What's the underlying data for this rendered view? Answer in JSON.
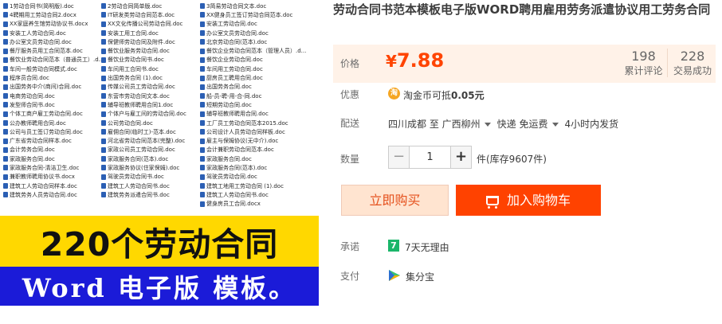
{
  "image": {
    "file_columns": [
      [
        "1劳动合同书(简明版).doc",
        "4聘期用工劳动合同2.docx",
        "XX家庭养生馆劳动协议书.docx",
        "安装工人劳动合同.doc",
        "办公室文员劳动合同.doc",
        "餐厅服务员用工合同范本.doc",
        "餐饮业劳动合同范本（普通员工）.d...",
        "车间一般劳动合同模式.doc",
        "程序员合同.doc",
        "出国劳务中介(商间)合同.doc",
        "电商劳动合同.doc",
        "发型师合同书.doc",
        "个体工商户雇工劳动合同.doc",
        "公办教师聘用合同.doc",
        "公司与员工签订劳动合同.doc",
        "广东省劳动合同样本.doc",
        "会计劳务合同.doc",
        "家政服务合同.doc",
        "家政服务合同-清洁卫生.doc",
        "兼职教师聘用协议书.docx",
        "建筑工人劳动合同样本.doc",
        "建筑劳务人员劳动合同.doc"
      ],
      [
        "2劳动合同简单版.doc",
        "IT研发类劳动合同范本.doc",
        "XX文化传播公司劳动合同.doc",
        "安装工用工合同.doc",
        "保健师劳动合同及附件.doc",
        "餐饮业服务劳动合同.doc",
        "餐饮业劳动合同书.doc",
        "车间用工合同书.doc",
        "出国劳务合同 (1).doc",
        "传媒公司员工劳动合同.doc",
        "东营市劳动合同文本.doc",
        "辅导班教师聘用合同1.doc",
        "个体户与雇工间的劳动合同.doc",
        "公司劳动合同.doc",
        "雇佣合同(临时工)-范本.doc",
        "河北省劳动合同范本(完整).doc",
        "家政公司员工劳动合同.doc",
        "家政服务合同(范本).doc",
        "家政服务协议(住家保姆).doc",
        "驾驶员劳动合同书.doc",
        "建筑工人劳动合同书.doc",
        "建筑劳务派遣合同书.doc"
      ],
      [
        "3简易劳动合同文本.doc",
        "XX健身员工签订劳动合同范本.doc",
        "安装工劳动合同.doc",
        "办公室文员劳动合同.doc",
        "北京劳动合同(范本).doc",
        "餐饮企业劳动合同范本（管理人员）.d...",
        "餐饮企业劳动合同.doc",
        "车间用工劳动合同.doc",
        "厨房员工聘用合同.doc",
        "出国劳务合同.doc",
        "船-员-聘-用-合-同.doc",
        "短期劳动合同.doc",
        "辅导班教师聘用合同.doc",
        "工厂员工劳动合同范本2015.doc",
        "公司设计人员劳动合同样板.doc",
        "雇主与保姆协议(无中介).doc",
        "会计兼职劳动合同范本.doc",
        "家政服务合同.doc",
        "家政服务合同(范本).doc",
        "驾驶员劳动合同.doc",
        "建筑工地用工劳动合同 (1).doc",
        "建筑工人劳动合同书.doc",
        "健身房员工合同.docx"
      ]
    ],
    "banner_main": "220个劳动合同",
    "banner_sub": "Word 电子版 模板。"
  },
  "product": {
    "title": "劳动合同书范本模板电子版WORD聘用雇用劳务派遣协议用工劳务合同",
    "price_label": "价格",
    "currency": "¥",
    "price": "7.88",
    "stats": [
      {
        "num": "198",
        "label": "累计评论"
      },
      {
        "num": "228",
        "label": "交易成功"
      }
    ],
    "discount_label": "优惠",
    "coin_icon": "淘",
    "coin_text_prefix": "淘金币可抵",
    "coin_amount": "0.05元",
    "ship_label": "配送",
    "ship_from": "四川成都 至",
    "ship_to": "广西柳州",
    "ship_method": "快递 免运费",
    "ship_time": "4小时内发货",
    "qty_label": "数量",
    "qty_value": "1",
    "qty_minus": "−",
    "qty_plus": "+",
    "stock": "件(库存9607件)",
    "buy_now": "立即购买",
    "add_cart": "加入购物车",
    "promise_label": "承诺",
    "promise_icon": "7",
    "promise_text": "7天无理由",
    "pay_label": "支付",
    "pay_text": "集分宝"
  },
  "colors": {
    "price": "#ff4400",
    "cart_button": "#ff4200",
    "buy_button_bg": "#ffe4d0",
    "banner_yellow": "#ffd800",
    "banner_blue": "#1b1bd8"
  },
  "icons": [
    "doc-file-icon",
    "coin-icon",
    "caret-down-icon",
    "cart-icon",
    "seven-day-icon",
    "jifenbao-icon"
  ]
}
